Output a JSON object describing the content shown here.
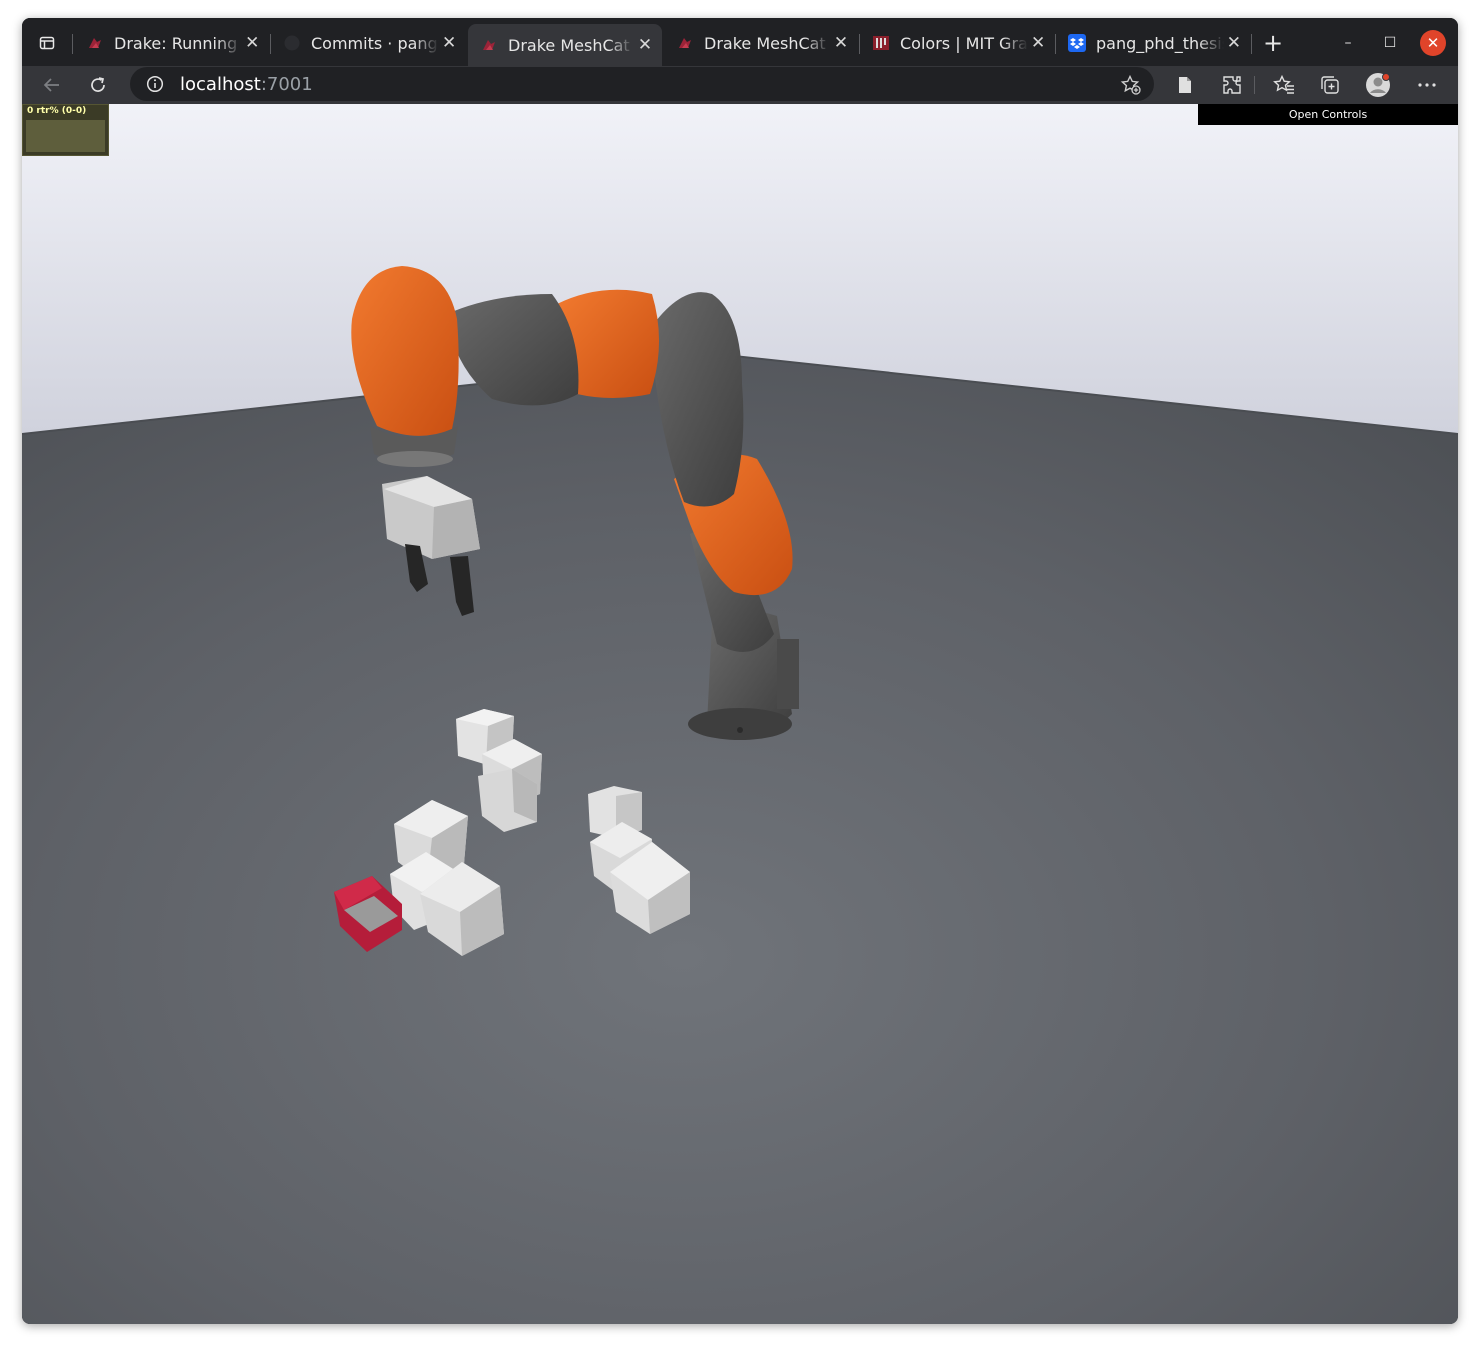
{
  "browser": {
    "tabs": [
      {
        "title": "Drake: Running Pr",
        "favicon": "drake-icon",
        "active": false
      },
      {
        "title": "Commits · pangta",
        "favicon": "github-icon",
        "active": false
      },
      {
        "title": "Drake MeshCat",
        "favicon": "drake-icon",
        "active": true
      },
      {
        "title": "Drake MeshCat",
        "favicon": "drake-icon",
        "active": false
      },
      {
        "title": "Colors | MIT Grapl",
        "favicon": "mit-icon",
        "active": false
      },
      {
        "title": "pang_phd_thesis.",
        "favicon": "dropbox-icon",
        "active": false
      }
    ],
    "close_glyph": "✕",
    "new_tab_glyph": "+",
    "address": {
      "host": "localhost",
      "port": ":7001"
    },
    "window_controls": {
      "minimize": "–",
      "maximize": "☐",
      "close": "✕"
    }
  },
  "meshcat": {
    "stats_label": "0 rtr% (0-0)",
    "controls_button": "Open Controls"
  },
  "colors": {
    "robot_orange": "#e35f1d",
    "robot_gray": "#4f4f4f",
    "floor": "#5b5e63",
    "sky": "#e9ebf3",
    "target_box": "#b51d3a",
    "cubes": "#d9d9d9"
  }
}
